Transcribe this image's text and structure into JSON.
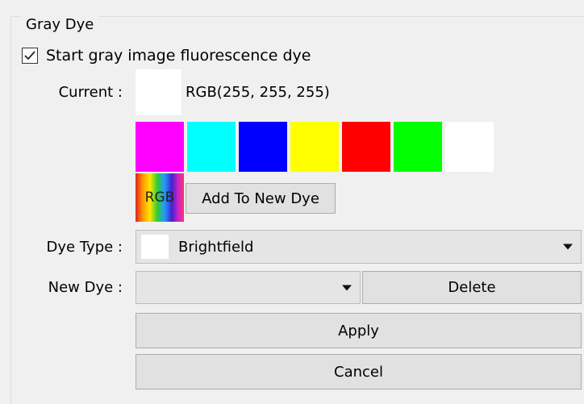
{
  "group": {
    "title": "Gray Dye"
  },
  "start_checkbox": {
    "label": "Start gray image fluorescence dye",
    "checked": true
  },
  "current": {
    "label": "Current :",
    "rgb_text": "RGB(255, 255, 255)",
    "color": "#ffffff"
  },
  "palette": {
    "colors": [
      "#ff00ff",
      "#00ffff",
      "#0000ff",
      "#ffff00",
      "#ff0000",
      "#00ff00",
      "#ffffff"
    ]
  },
  "rgb_picker": {
    "label": "RGB"
  },
  "add_button": {
    "label": "Add To New Dye"
  },
  "dye_type": {
    "label": "Dye Type :",
    "value": "Brightfield",
    "swatch_color": "#ffffff"
  },
  "new_dye": {
    "label": "New Dye :",
    "value": ""
  },
  "delete_button": {
    "label": "Delete"
  },
  "apply_button": {
    "label": "Apply"
  },
  "cancel_button": {
    "label": "Cancel"
  }
}
